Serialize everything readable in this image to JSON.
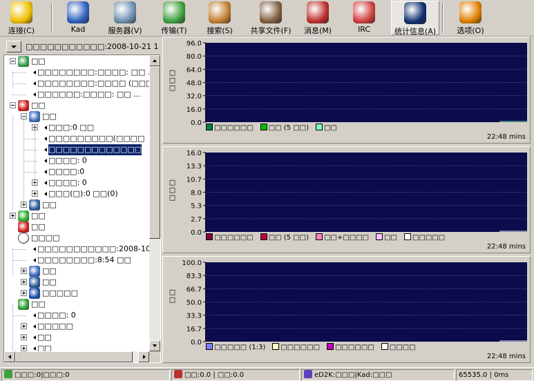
{
  "toolbar": {
    "buttons": [
      {
        "label": "连接(C)",
        "icon": "lightning-icon",
        "color": "#f0c000"
      },
      {
        "label": "Kad",
        "icon": "globe-icon",
        "color": "#3060c0"
      },
      {
        "label": "服务器(V)",
        "icon": "server-icon",
        "color": "#7090b0"
      },
      {
        "label": "传输(T)",
        "icon": "transfer-icon",
        "color": "#40a040"
      },
      {
        "label": "搜索(S)",
        "icon": "magnifier-icon",
        "color": "#c08030"
      },
      {
        "label": "共享文件(F)",
        "icon": "shared-files-icon",
        "color": "#806040"
      },
      {
        "label": "消息(M)",
        "icon": "message-icon",
        "color": "#c03030"
      },
      {
        "label": "IRC",
        "icon": "irc-icon",
        "color": "#d04040"
      },
      {
        "label": "统计信息(A)",
        "icon": "statistics-icon",
        "color": "#103070"
      },
      {
        "label": "选项(O)",
        "icon": "gear-icon",
        "color": "#e08000"
      }
    ],
    "active": "统计信息(A)"
  },
  "tree": {
    "header": "□□□□□□□□□□□:2008-10-21 1",
    "nodes": [
      {
        "text": "□□",
        "level": 0,
        "icon": "updown-icon",
        "exp": "minus"
      },
      {
        "text": "□□□□□□□□:□□□□: □□ ...",
        "level": 1,
        "icon": "bullet"
      },
      {
        "text": "□□□□□□□□:□□□□ (□□□□",
        "level": 1,
        "icon": "bullet"
      },
      {
        "text": "□□□□□□:□□□□: □□ ...",
        "level": 1,
        "icon": "bullet"
      },
      {
        "text": "□□",
        "level": 0,
        "icon": "upload-arrow-icon",
        "exp": "minus"
      },
      {
        "text": "□□",
        "level": 1,
        "icon": "user-icon",
        "exp": "minus"
      },
      {
        "text": "□□□:0 □□",
        "level": 2,
        "icon": "bullet",
        "exp": "plus"
      },
      {
        "text": "□□□□□□□□□(□□□□",
        "level": 2,
        "icon": "bullet"
      },
      {
        "text": "□□□□□□□□□□□□□",
        "level": 2,
        "icon": "bullet",
        "selected": true
      },
      {
        "text": "□□□□: 0",
        "level": 2,
        "icon": "bullet"
      },
      {
        "text": "□□□□:0",
        "level": 2,
        "icon": "bullet"
      },
      {
        "text": "□□□□: 0",
        "level": 2,
        "icon": "bullet",
        "exp": "plus"
      },
      {
        "text": "□□□(□):0 □□(0)",
        "level": 2,
        "icon": "bullet",
        "exp": "plus"
      },
      {
        "text": "□□",
        "level": 1,
        "icon": "disk-icon",
        "exp": "plus"
      },
      {
        "text": "□□",
        "level": 0,
        "icon": "download-arrow-icon",
        "exp": "plus"
      },
      {
        "text": "□□",
        "level": 0,
        "icon": "connection-icon"
      },
      {
        "text": "□□□□",
        "level": 0,
        "icon": "clock-icon"
      },
      {
        "text": "□□□□□□□□□□□:2008-10-21",
        "level": 1,
        "icon": "bullet"
      },
      {
        "text": "□□□□□□□□:8:54 □□",
        "level": 1,
        "icon": "bullet"
      },
      {
        "text": "□□",
        "level": 1,
        "icon": "user-icon",
        "exp": "plus"
      },
      {
        "text": "□□",
        "level": 1,
        "icon": "disk-icon",
        "exp": "plus"
      },
      {
        "text": "□□□□□",
        "level": 1,
        "icon": "bars-icon",
        "exp": "plus"
      },
      {
        "text": "□□",
        "level": 0,
        "icon": "people-icon"
      },
      {
        "text": "□□□□: 0",
        "level": 1,
        "icon": "bullet"
      },
      {
        "text": "□□□□□",
        "level": 1,
        "icon": "bullet",
        "exp": "plus"
      },
      {
        "text": "□□",
        "level": 1,
        "icon": "bullet",
        "exp": "plus"
      },
      {
        "text": "□□",
        "level": 1,
        "icon": "bullet",
        "exp": "plus"
      }
    ]
  },
  "chart_data": [
    {
      "type": "line",
      "ylabel": "□□□",
      "yticks": [
        "96.0",
        "80.0",
        "64.0",
        "48.0",
        "32.0",
        "16.0",
        "0.0"
      ],
      "ylim": [
        0,
        96
      ],
      "time_label": "22:48 mins",
      "grid": true,
      "background": "#0c0c4c",
      "series": [
        {
          "name": "□□□□□□",
          "color": "#008040",
          "values": [
            0,
            0
          ]
        },
        {
          "name": "□□ (5 □□)",
          "color": "#00c000",
          "values": [
            0,
            0
          ]
        },
        {
          "name": "□□",
          "color": "#80ffc0",
          "values": [
            0,
            0
          ]
        }
      ]
    },
    {
      "type": "line",
      "ylabel": "□□□",
      "yticks": [
        "16.0",
        "13.3",
        "10.7",
        "8.0",
        "5.3",
        "2.7",
        "0.0"
      ],
      "ylim": [
        0,
        16
      ],
      "time_label": "22:48 mins",
      "grid": true,
      "background": "#0c0c4c",
      "series": [
        {
          "name": "□□□□□□",
          "color": "#800040",
          "values": [
            0,
            0
          ]
        },
        {
          "name": "□□ (5 □□)",
          "color": "#c00040",
          "values": [
            0,
            0
          ]
        },
        {
          "name": "□□+□□□□",
          "color": "#ff80c0",
          "values": [
            0,
            0
          ]
        },
        {
          "name": "□□",
          "color": "#ffc0ff",
          "values": [
            0,
            0
          ]
        },
        {
          "name": "□□□□□",
          "color": "#ffffff",
          "values": [
            0,
            0
          ]
        }
      ]
    },
    {
      "type": "line",
      "ylabel": "□□",
      "yticks": [
        "100.0",
        "83.3",
        "66.7",
        "50.0",
        "33.3",
        "16.7",
        "0.0"
      ],
      "ylim": [
        0,
        100
      ],
      "time_label": "22:48 mins",
      "grid": true,
      "background": "#0c0c4c",
      "series": [
        {
          "name": "□□□□□ (1:3)",
          "color": "#8080ff",
          "values": [
            0,
            0
          ]
        },
        {
          "name": "□□□□□□",
          "color": "#ffffc0",
          "values": [
            0,
            0
          ]
        },
        {
          "name": "□□□□□□",
          "color": "#c000c0",
          "values": [
            0,
            0
          ]
        },
        {
          "name": "□□□□",
          "color": "#ffffff",
          "values": [
            0,
            0
          ]
        }
      ]
    }
  ],
  "status": {
    "users": "□□□:0|□□□:0",
    "speed": "□□:0.0 | □□:0.0",
    "network": "eD2K:□□□|Kad:□□□",
    "ping": "65535.0 | 0ms"
  }
}
